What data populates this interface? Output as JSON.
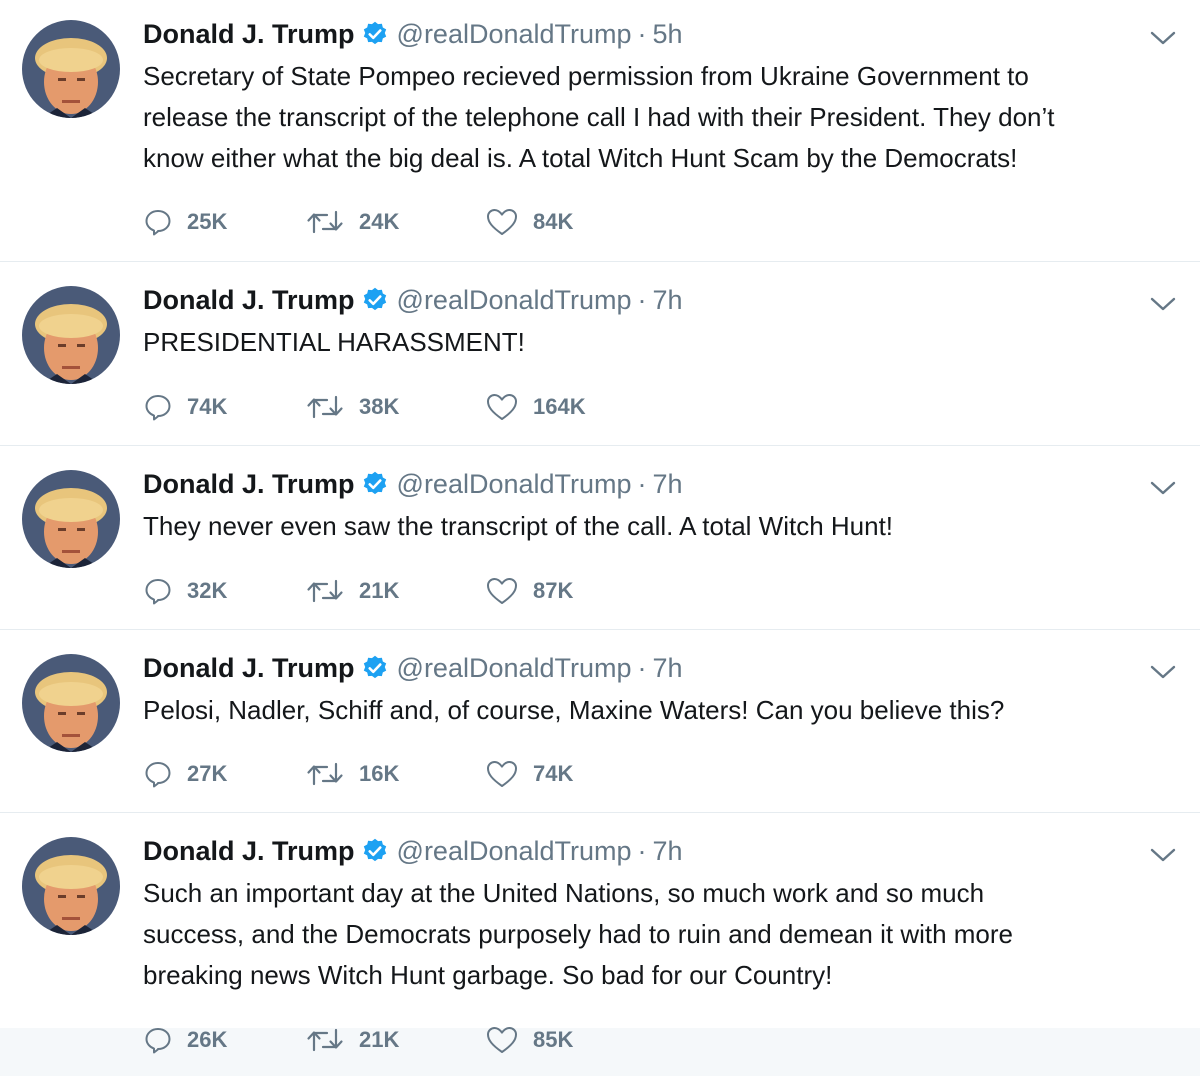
{
  "tweets": [
    {
      "name": "Donald J. Trump",
      "handle": "@realDonaldTrump",
      "separator": "·",
      "time": "5h",
      "text": "Secretary of State Pompeo recieved permission from Ukraine Government to\nrelease the transcript of the telephone call I had with their President. They don’t\nknow either what the big deal is. A total Witch Hunt Scam by the Democrats!",
      "replies": "25K",
      "retweets": "24K",
      "likes": "84K"
    },
    {
      "name": "Donald J. Trump",
      "handle": "@realDonaldTrump",
      "separator": "·",
      "time": "7h",
      "text": "PRESIDENTIAL HARASSMENT!",
      "replies": "74K",
      "retweets": "38K",
      "likes": "164K"
    },
    {
      "name": "Donald J. Trump",
      "handle": "@realDonaldTrump",
      "separator": "·",
      "time": "7h",
      "text": "They never even saw the transcript of the call. A total Witch Hunt!",
      "replies": "32K",
      "retweets": "21K",
      "likes": "87K"
    },
    {
      "name": "Donald J. Trump",
      "handle": "@realDonaldTrump",
      "separator": "·",
      "time": "7h",
      "text": "Pelosi, Nadler, Schiff and, of course, Maxine Waters! Can you believe this?",
      "replies": "27K",
      "retweets": "16K",
      "likes": "74K"
    },
    {
      "name": "Donald J. Trump",
      "handle": "@realDonaldTrump",
      "separator": "·",
      "time": "7h",
      "text": "Such an important day at the United Nations, so much work and so much\nsuccess, and the Democrats purposely had to ruin and demean it with more\nbreaking news Witch Hunt garbage. So bad for our Country!",
      "replies": "26K",
      "retweets": "21K",
      "likes": "85K"
    }
  ],
  "icons": {
    "verified": "verified-badge-icon",
    "reply": "reply-icon",
    "retweet": "retweet-icon",
    "like": "heart-icon",
    "menu": "chevron-down-icon"
  },
  "colors": {
    "text": "#14171a",
    "secondary": "#657786",
    "verified": "#1da1f2",
    "divider": "#e6ecf0"
  }
}
